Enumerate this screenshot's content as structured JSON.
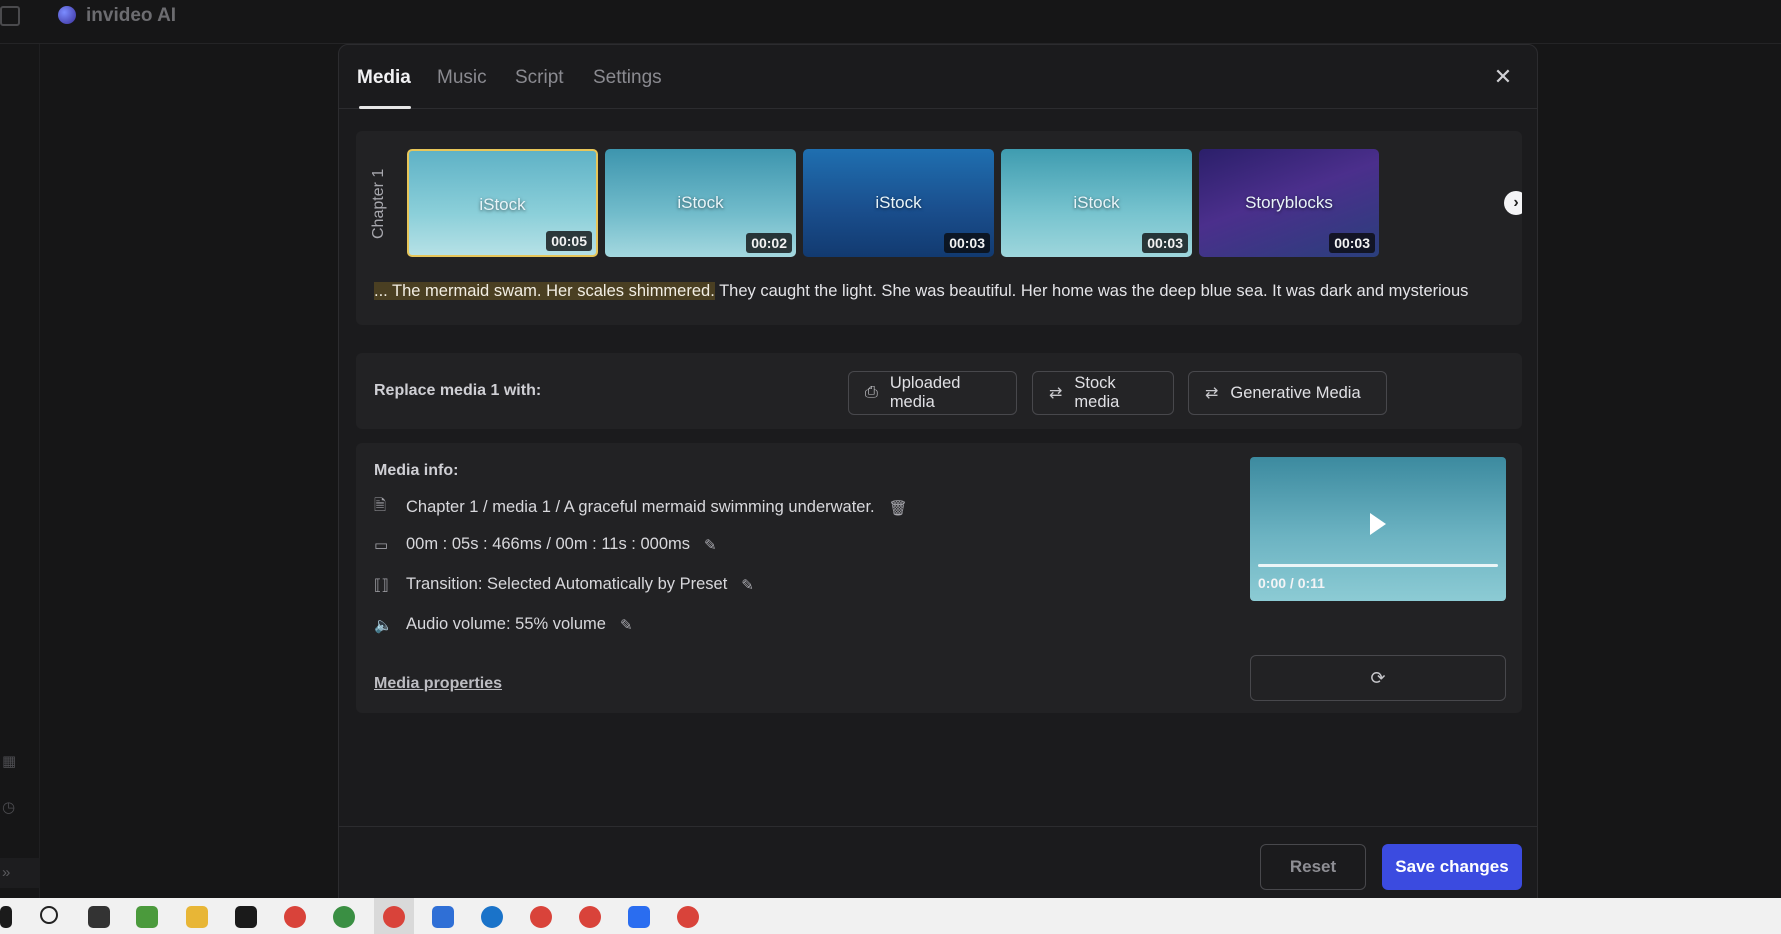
{
  "app": {
    "brand": "invideo AI"
  },
  "tabs": [
    {
      "label": "Media",
      "active": true
    },
    {
      "label": "Music",
      "active": false
    },
    {
      "label": "Script",
      "active": false
    },
    {
      "label": "Settings",
      "active": false
    }
  ],
  "close_icon": "close-icon",
  "chapter": {
    "label": "Chapter 1",
    "thumbnails": [
      {
        "source": "iStock",
        "duration": "00:05",
        "selected": true
      },
      {
        "source": "iStock",
        "duration": "00:02",
        "selected": false
      },
      {
        "source": "iStock",
        "duration": "00:03",
        "selected": false
      },
      {
        "source": "iStock",
        "duration": "00:03",
        "selected": false
      },
      {
        "source": "Storyblocks",
        "duration": "00:03",
        "selected": false
      }
    ],
    "script_highlight": "... The mermaid swam. Her scales shimmered.",
    "script_rest": " They caught the light. She was beautiful. Her home was the deep blue sea. It was dark and mysterious"
  },
  "replace": {
    "label": "Replace media 1 with:",
    "buttons": [
      {
        "label": "Uploaded media",
        "icon": "upload-file-icon"
      },
      {
        "label": "Stock media",
        "icon": "swap-media-icon"
      },
      {
        "label": "Generative Media",
        "icon": "swap-media-icon"
      }
    ]
  },
  "media_info": {
    "title": "Media info:",
    "description": "Chapter 1 / media 1 / A graceful mermaid swimming underwater.",
    "timing": "00m : 05s : 466ms / 00m : 11s : 000ms",
    "transition": "Transition: Selected Automatically by Preset",
    "audio": "Audio volume: 55% volume",
    "properties_link": "Media properties",
    "preview_time": "0:00 / 0:11",
    "preview_progress": 0.0
  },
  "footer": {
    "reset_label": "Reset",
    "save_label": "Save changes"
  },
  "colors": {
    "accent": "#3b4be0",
    "selected_border": "#e7c65a",
    "highlight_bg": "#4a3f22"
  }
}
